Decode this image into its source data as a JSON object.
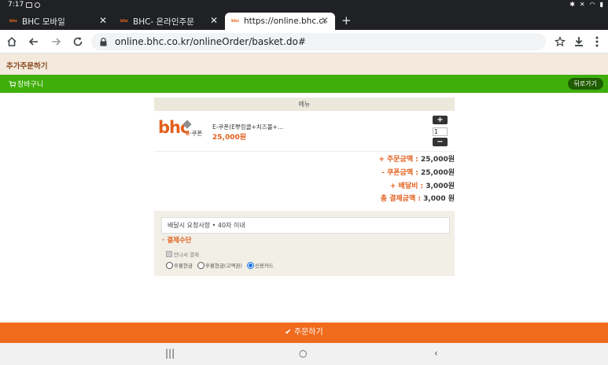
{
  "status": {
    "time": "7:17"
  },
  "tabs": [
    {
      "title": "BHC 모바일"
    },
    {
      "title": "BHC- 온라인주문"
    },
    {
      "title": "https://online.bhc.co.kr/o"
    }
  ],
  "browser": {
    "url": "online.bhc.co.kr/onlineOrder/basket.do#"
  },
  "page": {
    "section_title": "추가주문하기",
    "cart_label": "장바구니",
    "back_label": "뒤로가기",
    "menu_header": "메뉴",
    "logo": {
      "brand": "bhc",
      "coupon_prefix": "e",
      "coupon_text": "·쿠폰"
    },
    "item": {
      "name": "E-쿠폰(E뿌링클+치즈볼+…",
      "price": "25,000원",
      "qty": "1"
    },
    "qty_plus": "+",
    "qty_minus": "−",
    "summary": [
      {
        "label": "+ 주문금액 :",
        "value": "25,000원"
      },
      {
        "label": "- 쿠폰금액 :",
        "value": "25,000원"
      },
      {
        "label": "+ 배달비 :",
        "value": "3,000원"
      },
      {
        "label": "총 결제금액 :",
        "value": "3,000 원"
      }
    ],
    "request_placeholder": "배달시 요청사항 • 40자 이내",
    "payment_title": "· 결제수단",
    "payment_checkbox": "만나서 결제",
    "payment_options": [
      {
        "label": "후불현금",
        "selected": false
      },
      {
        "label": "후불현금(고액권)",
        "selected": false
      },
      {
        "label": "신용카드",
        "selected": true
      }
    ],
    "order_button": "주문하기"
  }
}
